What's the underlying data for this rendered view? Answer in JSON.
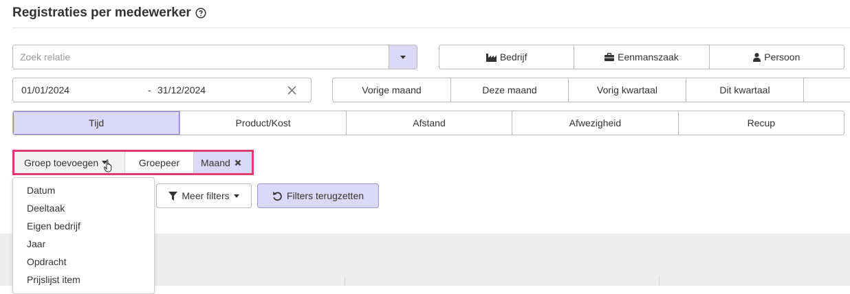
{
  "page": {
    "title": "Registraties per medewerker"
  },
  "search": {
    "placeholder": "Zoek relatie"
  },
  "relation_types": [
    "Bedrijf",
    "Eenmanszaak",
    "Persoon"
  ],
  "date_range": {
    "start": "01/01/2024",
    "separator": "-",
    "end": "31/12/2024"
  },
  "periods": [
    "Vorige maand",
    "Deze maand",
    "Vorig kwartaal",
    "Dit kwartaal"
  ],
  "categories": [
    "Tijd",
    "Product/Kost",
    "Afstand",
    "Afwezigheid",
    "Recup"
  ],
  "categories_active": "Tijd",
  "group_bar": {
    "add_label": "Groep toevoegen",
    "group_label": "Groepeer",
    "chip_label": "Maand"
  },
  "filters": {
    "more_label": "Meer filters",
    "reset_label": "Filters terugzetten"
  },
  "group_dropdown": [
    "Datum",
    "Deeltaak",
    "Eigen bedrijf",
    "Jaar",
    "Opdracht",
    "Prijslijst item"
  ],
  "colors": {
    "accent": "#dcd8f7",
    "highlight_border": "#dc3c6e"
  }
}
